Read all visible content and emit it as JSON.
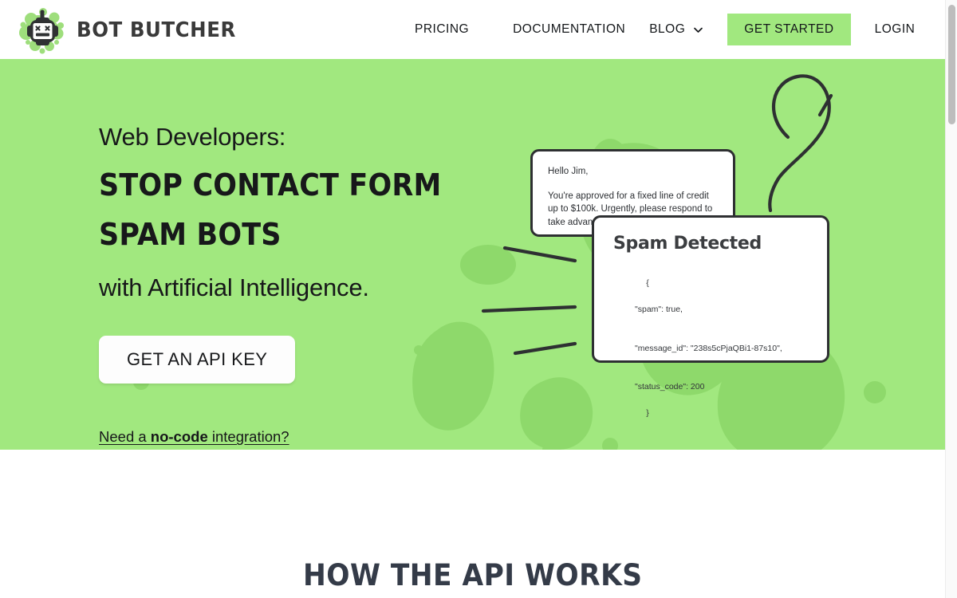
{
  "brand": {
    "name": "BOT BUTCHER",
    "logo_icon": "robot-head-x-eyes-icon"
  },
  "nav": {
    "items": [
      {
        "label": "PRICING",
        "name": "pricing"
      },
      {
        "label": "DOCUMENTATION",
        "name": "documentation"
      },
      {
        "label": "BLOG",
        "name": "blog",
        "has_dropdown": true
      },
      {
        "label": "LOGIN",
        "name": "login"
      }
    ],
    "cta_label": "GET STARTED",
    "chevron_icon": "chevron-down-icon"
  },
  "hero": {
    "eyebrow": "Web Developers:",
    "headline_line1": "STOP CONTACT FORM",
    "headline_line2": "SPAM BOTS",
    "subhead": "with Artificial Intelligence.",
    "cta_label": "GET AN API KEY",
    "nocode_prefix": "Need a ",
    "nocode_strong": "no-code",
    "nocode_suffix": " integration?",
    "background_color": "#a1e87f",
    "blob_color": "#8ed96b"
  },
  "email_card": {
    "greeting": "Hello Jim,",
    "body": "You're approved for a fixed line of credit up to $100k. Urgently, please respond to take advantage of this limited time offer."
  },
  "spam_card": {
    "title": "Spam Detected",
    "json_open": "{",
    "json_lines": [
      "\"spam\": true,",
      "\"message_id\": \"238s5cPjaQBi1-87s10\",",
      "\"status_code\": 200"
    ],
    "json_close": "}"
  },
  "section": {
    "heading": "HOW THE API WORKS"
  },
  "scrollbar": {
    "thumb_color": "#bdbdbd"
  }
}
